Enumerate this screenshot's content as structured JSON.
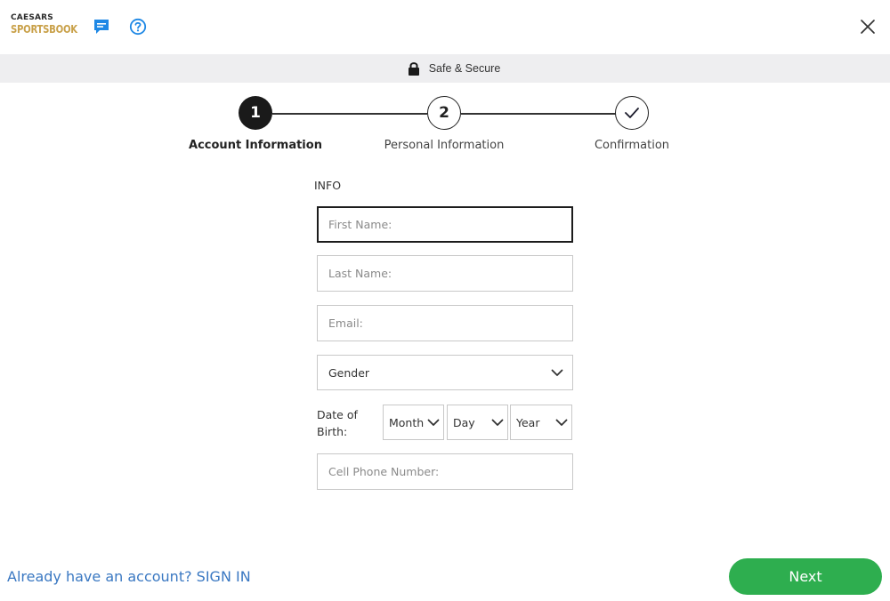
{
  "header": {
    "logo_line1": "CAESARS",
    "logo_line2": "SPORTSBOOK",
    "icons": [
      "chat-icon",
      "help-icon",
      "close-icon"
    ]
  },
  "secure_bar": {
    "icon": "lock-icon",
    "text": "Safe & Secure"
  },
  "stepper": {
    "steps": [
      {
        "number": "1",
        "label": "Account Information",
        "state": "active"
      },
      {
        "number": "2",
        "label": "Personal Information",
        "state": "upcoming"
      },
      {
        "icon": "checkmark-icon",
        "label": "Confirmation",
        "state": "upcoming"
      }
    ]
  },
  "form": {
    "section_title": "INFO",
    "first_name": {
      "placeholder": "First Name:",
      "value": ""
    },
    "last_name": {
      "placeholder": "Last Name:",
      "value": ""
    },
    "email": {
      "placeholder": "Email:",
      "value": ""
    },
    "gender": {
      "selected": "Gender"
    },
    "dob": {
      "label": "Date of Birth:",
      "month": "Month",
      "day": "Day",
      "year": "Year"
    },
    "cell_phone": {
      "placeholder": "Cell Phone Number:",
      "value": ""
    }
  },
  "footer": {
    "signin_text": "Already have an account? SIGN IN",
    "next_label": "Next"
  },
  "colors": {
    "brand_gold": "#c9a14a",
    "accent_blue": "#1e88e5",
    "link_blue": "#3a78c2",
    "next_green": "#2eae4f",
    "secure_bar_bg": "#eeeef0"
  }
}
